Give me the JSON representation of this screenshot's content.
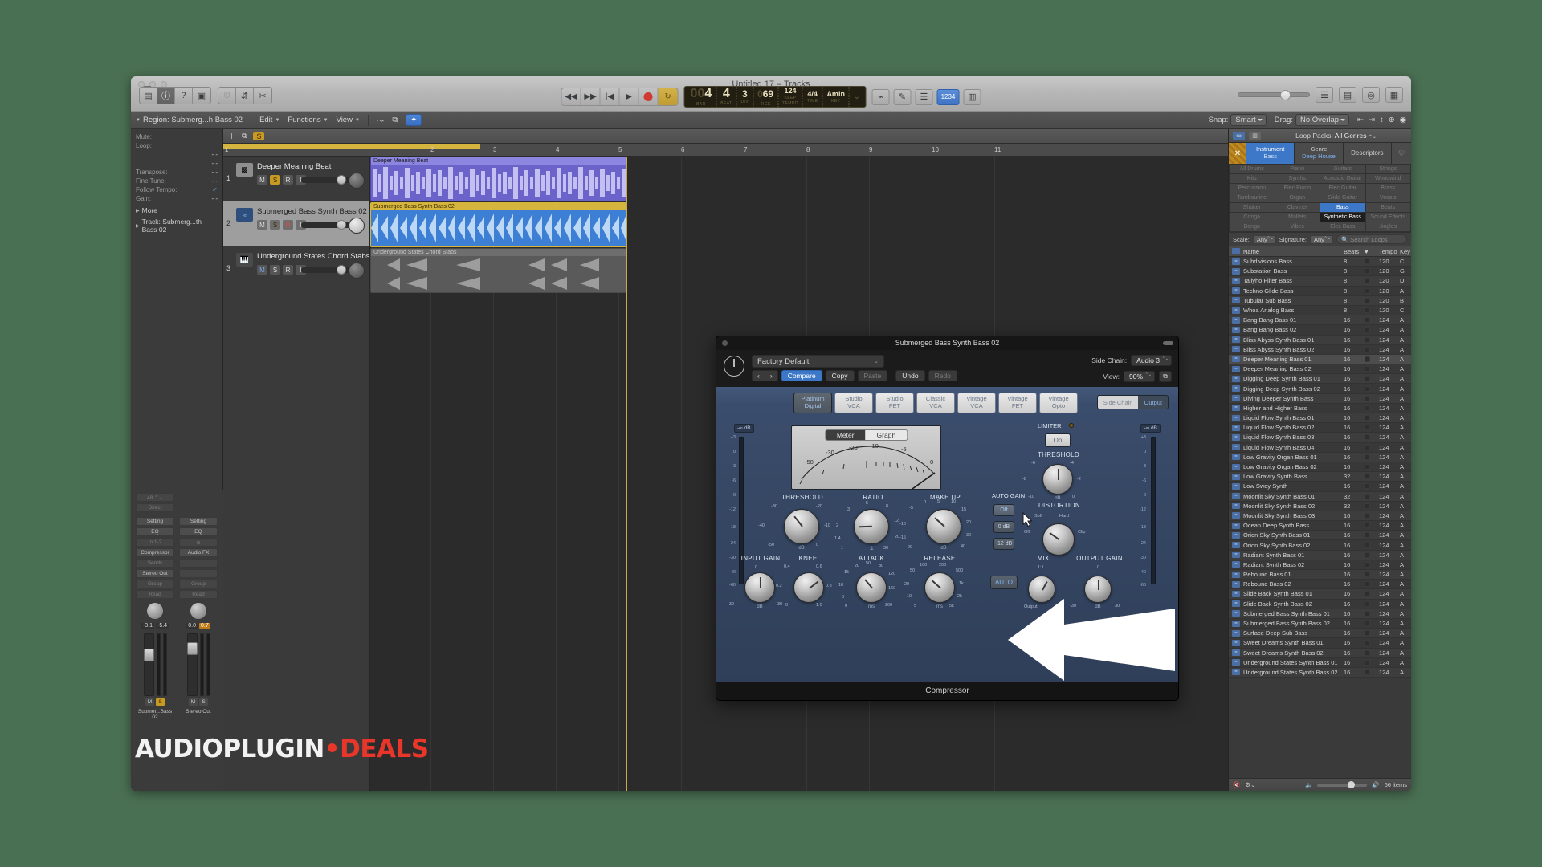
{
  "window": {
    "title": "Untitled 17 – Tracks",
    "title_icon": "display-icon"
  },
  "toolbar": {
    "left_buttons": [
      "library-icon",
      "info-icon",
      "help-icon",
      "note-pad-icon"
    ],
    "tool_buttons": [
      "metronome-icon",
      "mixer-icon",
      "scissors-icon"
    ],
    "transport": [
      "rewind-icon",
      "forward-icon",
      "go-to-start-icon",
      "play-icon",
      "record-icon",
      "cycle-icon"
    ],
    "right_buttons": [
      "list-icon",
      "loops-icon",
      "browser-icon",
      "mixer-view-icon"
    ],
    "lcd": {
      "bar_lead": "00",
      "bar": "4",
      "beat": "4",
      "div": "3",
      "tick_lead": "0",
      "tick": "69",
      "tempo": "124",
      "tempo_unit": "KEEP",
      "time_sig": "4/4",
      "key": "Amin",
      "labels": {
        "bar": "BAR",
        "beat": "BEAT",
        "div": "DIV",
        "tick": "TICK",
        "tempo": "TEMPO",
        "time": "TIME",
        "key": "KEY"
      }
    },
    "mode_badge": "1234"
  },
  "menustrip": {
    "region_label": "Region: Submerg...h Bass 02",
    "menus": [
      "Edit",
      "Functions",
      "View"
    ],
    "tool_left": "pointer-icon",
    "tool_right": "pencil-icon",
    "snap_label": "Snap:",
    "snap_value": "Smart",
    "drag_label": "Drag:",
    "drag_value": "No Overlap",
    "loop_packs_label": "Loop Packs:",
    "loop_packs_value": "All Genres"
  },
  "inspector": {
    "header": "Region: Submerg...h Bass 02",
    "rows": [
      {
        "k": "Mute:",
        "v": ""
      },
      {
        "k": "Loop:",
        "v": ""
      },
      {
        "k": "",
        "v": "- -"
      },
      {
        "k": "",
        "v": "- -"
      },
      {
        "k": "Transpose:",
        "v": "- -"
      },
      {
        "k": "Fine Tune:",
        "v": "- -"
      },
      {
        "k": "Follow Tempo:",
        "v": "✓"
      },
      {
        "k": "Gain:",
        "v": "- -"
      }
    ],
    "more": "More",
    "track_row": "Track:  Submerg...th Bass 02"
  },
  "channel_strips": [
    {
      "name": "Submer...Bass 02",
      "setting": "Setting",
      "eq": "EQ",
      "io": "In 1-2",
      "insert": "Compressor",
      "sends": "Sends",
      "output": "Stereo Out",
      "group": "Group",
      "automation": "Read",
      "values": [
        "-3.1",
        "-5.4"
      ],
      "ms": [
        "M",
        "S"
      ]
    },
    {
      "name": "Stereo Out",
      "setting": "Setting",
      "eq": "EQ",
      "io": "",
      "insert": "Audio FX",
      "sends": "",
      "output": "",
      "group": "Group",
      "automation": "Read",
      "values": [
        "0.0",
        "0.7"
      ],
      "ms": [
        "M",
        "S"
      ]
    }
  ],
  "tracks_header": {
    "add_icon": "plus-icon",
    "copy_icon": "duplicate-icon",
    "solo_badge": "S"
  },
  "ruler": {
    "bars": [
      "1",
      "2",
      "3",
      "4",
      "5",
      "6",
      "7",
      "8",
      "9",
      "10",
      "11"
    ]
  },
  "tracks": [
    {
      "num": "1",
      "name": "Deeper Meaning Beat",
      "icon": "drum-machine-icon",
      "buttons": [
        "M",
        "S",
        "R",
        "I"
      ],
      "solo_on": true,
      "record_on": false,
      "selected": false,
      "region": {
        "title": "Deeper Meaning Beat",
        "color": "#6b63c9"
      }
    },
    {
      "num": "2",
      "name": "Submerged Bass Synth Bass 02",
      "icon": "audio-waveform-icon",
      "buttons": [
        "M",
        "S",
        "R",
        "I"
      ],
      "solo_on": true,
      "record_on": true,
      "selected": true,
      "region": {
        "title": "Submerged Bass Synth Bass 02",
        "color": "#3c7fd4"
      }
    },
    {
      "num": "3",
      "name": "Underground States Chord Stabs",
      "icon": "keyboard-icon",
      "buttons": [
        "M",
        "S",
        "R",
        "I"
      ],
      "solo_on": false,
      "record_on": false,
      "selected": false,
      "region": {
        "title": "Underground States Chord Stabs",
        "color": "#6e6e6e"
      }
    }
  ],
  "loop_browser": {
    "view_buttons": [
      "list-view-icon",
      "column-view-icon"
    ],
    "loop_packs_label": "Loop Packs:",
    "loop_packs_value": "All Genres",
    "tabs": [
      {
        "label": "Instrument",
        "value": "Bass",
        "active": true
      },
      {
        "label": "Genre",
        "value": "Deep House",
        "active": true
      },
      {
        "label": "Descriptors",
        "value": "",
        "active": false
      }
    ],
    "close_icon": "reset-x-icon",
    "favorite_icon": "heart-icon",
    "categories": [
      [
        "All Drums",
        "Piano",
        "Guitars",
        "Strings"
      ],
      [
        "Kits",
        "Synths",
        "Acoustic Guitar",
        "Woodwind"
      ],
      [
        "Percussion",
        "Elec Piano",
        "Elec Guitar",
        "Brass"
      ],
      [
        "Tambourine",
        "Organ",
        "Slide Guitar",
        "Vocals"
      ],
      [
        "Shaker",
        "Clavinet",
        "Bass",
        "Beats"
      ],
      [
        "Conga",
        "Mallets",
        "Synthetic Bass",
        "Sound Effects"
      ],
      [
        "Bongo",
        "Vibes",
        "Elec Bass",
        "Jingles"
      ]
    ],
    "category_selected": "Bass",
    "category_selected2": "Synthetic Bass",
    "scale_label": "Scale:",
    "scale_value": "Any",
    "signature_label": "Signature:",
    "signature_value": "Any",
    "search_placeholder": "Search Loops",
    "search_icon": "magnifier-icon",
    "columns": [
      "Name",
      "Beats",
      "fav-heart-icon",
      "Tempo",
      "Key"
    ],
    "rows": [
      {
        "name": "Subdivisions Bass",
        "beats": "8",
        "tempo": "120",
        "key": "C"
      },
      {
        "name": "Substation Bass",
        "beats": "8",
        "tempo": "120",
        "key": "G"
      },
      {
        "name": "Tallyho Filter Bass",
        "beats": "8",
        "tempo": "120",
        "key": "D"
      },
      {
        "name": "Techno Glide Bass",
        "beats": "8",
        "tempo": "120",
        "key": "A"
      },
      {
        "name": "Tubular Sub Bass",
        "beats": "8",
        "tempo": "120",
        "key": "B"
      },
      {
        "name": "Whoa Analog Bass",
        "beats": "8",
        "tempo": "120",
        "key": "C"
      },
      {
        "name": "Bang Bang Bass 01",
        "beats": "16",
        "tempo": "124",
        "key": "A"
      },
      {
        "name": "Bang Bang Bass 02",
        "beats": "16",
        "tempo": "124",
        "key": "A"
      },
      {
        "name": "Bliss Abyss Synth Bass 01",
        "beats": "16",
        "tempo": "124",
        "key": "A"
      },
      {
        "name": "Bliss Abyss Synth Bass 02",
        "beats": "16",
        "tempo": "124",
        "key": "A"
      },
      {
        "name": "Deeper Meaning Bass 01",
        "beats": "16",
        "tempo": "124",
        "key": "A",
        "selected": true
      },
      {
        "name": "Deeper Meaning Bass 02",
        "beats": "16",
        "tempo": "124",
        "key": "A"
      },
      {
        "name": "Digging Deep Synth Bass 01",
        "beats": "16",
        "tempo": "124",
        "key": "A"
      },
      {
        "name": "Digging Deep Synth Bass 02",
        "beats": "16",
        "tempo": "124",
        "key": "A"
      },
      {
        "name": "Diving Deeper Synth Bass",
        "beats": "16",
        "tempo": "124",
        "key": "A"
      },
      {
        "name": "Higher and Higher Bass",
        "beats": "16",
        "tempo": "124",
        "key": "A"
      },
      {
        "name": "Liquid Flow Synth Bass 01",
        "beats": "16",
        "tempo": "124",
        "key": "A"
      },
      {
        "name": "Liquid Flow Synth Bass 02",
        "beats": "16",
        "tempo": "124",
        "key": "A"
      },
      {
        "name": "Liquid Flow Synth Bass 03",
        "beats": "16",
        "tempo": "124",
        "key": "A"
      },
      {
        "name": "Liquid Flow Synth Bass 04",
        "beats": "16",
        "tempo": "124",
        "key": "A"
      },
      {
        "name": "Low Gravity Organ Bass 01",
        "beats": "16",
        "tempo": "124",
        "key": "A"
      },
      {
        "name": "Low Gravity Organ Bass 02",
        "beats": "16",
        "tempo": "124",
        "key": "A"
      },
      {
        "name": "Low Gravity Synth Bass",
        "beats": "32",
        "tempo": "124",
        "key": "A"
      },
      {
        "name": "Low Sway Synth",
        "beats": "16",
        "tempo": "124",
        "key": "A"
      },
      {
        "name": "Moonlit Sky Synth Bass 01",
        "beats": "32",
        "tempo": "124",
        "key": "A"
      },
      {
        "name": "Moonlit Sky Synth Bass 02",
        "beats": "32",
        "tempo": "124",
        "key": "A"
      },
      {
        "name": "Moonlit Sky Synth Bass 03",
        "beats": "16",
        "tempo": "124",
        "key": "A"
      },
      {
        "name": "Ocean Deep Synth Bass",
        "beats": "16",
        "tempo": "124",
        "key": "A"
      },
      {
        "name": "Orion Sky Synth Bass 01",
        "beats": "16",
        "tempo": "124",
        "key": "A"
      },
      {
        "name": "Orion Sky Synth Bass 02",
        "beats": "16",
        "tempo": "124",
        "key": "A"
      },
      {
        "name": "Radiant Synth Bass 01",
        "beats": "16",
        "tempo": "124",
        "key": "A"
      },
      {
        "name": "Radiant Synth Bass 02",
        "beats": "16",
        "tempo": "124",
        "key": "A"
      },
      {
        "name": "Rebound Bass 01",
        "beats": "16",
        "tempo": "124",
        "key": "A"
      },
      {
        "name": "Rebound Bass 02",
        "beats": "16",
        "tempo": "124",
        "key": "A"
      },
      {
        "name": "Slide Back Synth Bass 01",
        "beats": "16",
        "tempo": "124",
        "key": "A"
      },
      {
        "name": "Slide Back Synth Bass 02",
        "beats": "16",
        "tempo": "124",
        "key": "A"
      },
      {
        "name": "Submerged Bass Synth Bass 01",
        "beats": "16",
        "tempo": "124",
        "key": "A"
      },
      {
        "name": "Submerged Bass Synth Bass 02",
        "beats": "16",
        "tempo": "124",
        "key": "A"
      },
      {
        "name": "Surface Deep Sub Bass",
        "beats": "16",
        "tempo": "124",
        "key": "A"
      },
      {
        "name": "Sweet Dreams Synth Bass 01",
        "beats": "16",
        "tempo": "124",
        "key": "A"
      },
      {
        "name": "Sweet Dreams Synth Bass 02",
        "beats": "16",
        "tempo": "124",
        "key": "A"
      },
      {
        "name": "Underground States Synth Bass 01",
        "beats": "16",
        "tempo": "124",
        "key": "A"
      },
      {
        "name": "Underground States Synth Bass 02",
        "beats": "16",
        "tempo": "124",
        "key": "A"
      }
    ],
    "footer": {
      "mute_icon": "speaker-mute-icon",
      "gear_icon": "gear-icon",
      "vol_low_icon": "speaker-low-icon",
      "vol_high_icon": "speaker-high-icon",
      "item_count": "66 items"
    }
  },
  "plugin": {
    "window_title": "Submerged Bass Synth Bass 02",
    "power_icon": "power-icon",
    "preset": "Factory Default",
    "buttons": {
      "prev": "‹",
      "next": "›",
      "compare": "Compare",
      "copy": "Copy",
      "paste": "Paste",
      "undo": "Undo",
      "redo": "Redo"
    },
    "side_chain_label": "Side Chain:",
    "side_chain_value": "Audio 3",
    "view_label": "View:",
    "view_value": "90%",
    "link_icon": "link-icon",
    "footer_title": "Compressor",
    "models": [
      {
        "l1": "Platinum",
        "l2": "Digital",
        "active": true
      },
      {
        "l1": "Studio",
        "l2": "VCA",
        "active": false
      },
      {
        "l1": "Studio",
        "l2": "FET",
        "active": false
      },
      {
        "l1": "Classic",
        "l2": "VCA",
        "active": false
      },
      {
        "l1": "Vintage",
        "l2": "VCA",
        "active": false
      },
      {
        "l1": "Vintage",
        "l2": "FET",
        "active": false
      },
      {
        "l1": "Vintage",
        "l2": "Opto",
        "active": false
      }
    ],
    "scout": [
      {
        "label": "Side Chain",
        "active": false
      },
      {
        "label": "Output",
        "active": true
      }
    ],
    "meter_toggle": [
      {
        "label": "Meter",
        "active": true
      },
      {
        "label": "Graph",
        "active": false
      }
    ],
    "vu_ticks": [
      "-50",
      "-30",
      "-20",
      "-10",
      "-5",
      "0"
    ],
    "input_db": "-∞ dB",
    "output_db": "-∞ dB",
    "input_scale": [
      "+3",
      "0",
      "-3",
      "-6",
      "-9",
      "-12",
      "-18",
      "-24",
      "-30",
      "-40",
      "-60"
    ],
    "output_scale": [
      "+3",
      "0",
      "-3",
      "-6",
      "-9",
      "-12",
      "-18",
      "-24",
      "-30",
      "-40",
      "-60"
    ],
    "knobs": [
      {
        "name": "THRESHOLD",
        "unit": "dB",
        "ticks": [
          "-50",
          "-40",
          "-30",
          "-20",
          "-10",
          "0"
        ],
        "angle": -38
      },
      {
        "name": "RATIO",
        "unit": ":1",
        "ticks": [
          "1",
          "1.4",
          "2",
          "3",
          "5",
          "8",
          "12",
          "20",
          "30"
        ],
        "angle": -90
      },
      {
        "name": "MAKE UP",
        "unit": "dB",
        "ticks": [
          "-20",
          "-15",
          "-10",
          "-5",
          "0",
          "5",
          "10",
          "15",
          "20",
          "30",
          "40",
          "50"
        ],
        "angle": -48
      },
      {
        "name": "INPUT GAIN",
        "unit": "dB",
        "ticks": [
          "-30",
          "0",
          "30"
        ],
        "angle": 0
      },
      {
        "name": "KNEE",
        "unit": "",
        "ticks": [
          "0",
          "0.2",
          "0.4",
          "0.6",
          "0.8",
          "1.0"
        ],
        "angle": 52
      },
      {
        "name": "ATTACK",
        "unit": "ms",
        "ticks": [
          "0",
          "5",
          "10",
          "15",
          "20",
          "50",
          "80",
          "120",
          "160",
          "200"
        ],
        "angle": -40
      },
      {
        "name": "RELEASE",
        "unit": "ms",
        "ticks": [
          "5",
          "10",
          "20",
          "50",
          "100",
          "200",
          "500",
          "1k",
          "2k",
          "5k"
        ],
        "angle": -48
      },
      {
        "name": "DISTORTION",
        "unit": "",
        "ticks": [
          "Off",
          "Soft",
          "Hard",
          "Clip"
        ],
        "angle": -55
      },
      {
        "name": "MIX",
        "unit": "1:1",
        "ticks": [
          "Output"
        ],
        "angle": 28
      },
      {
        "name": "OUTPUT GAIN",
        "unit": "dB",
        "ticks": [
          "-30",
          "0",
          "30"
        ],
        "angle": 0
      },
      {
        "name": "THRESHOLD",
        "unit": "dB",
        "ticks": [
          "-10",
          "-8",
          "-6",
          "-4",
          "-2",
          "0"
        ],
        "angle": 0
      }
    ],
    "auto_gain": {
      "label": "AUTO GAIN",
      "options": [
        {
          "label": "Off",
          "active": true
        },
        {
          "label": "0 dB",
          "active": false
        },
        {
          "label": "-12 dB",
          "active": false
        }
      ]
    },
    "limiter": {
      "label": "LIMITER",
      "on_label": "On",
      "threshold_label": "THRESHOLD",
      "unit": "dB"
    },
    "distortion": {
      "label": "DISTORTION",
      "marks": [
        "Off",
        "Soft",
        "Hard",
        "Clip"
      ]
    },
    "auto_button": "AUTO",
    "mix_label": "MIX",
    "mix_top": "1:1",
    "mix_bottom": "Output"
  },
  "watermark": {
    "part1": "AUDIOPLUGIN",
    "dot": "•",
    "part2": "DEALS"
  }
}
